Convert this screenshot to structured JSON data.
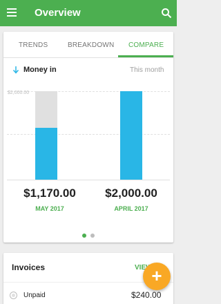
{
  "appbar": {
    "title": "Overview",
    "menu_icon": "menu-icon",
    "search_icon": "search-icon"
  },
  "tabs": [
    {
      "label": "TRENDS",
      "active": false
    },
    {
      "label": "BREAKDOWN",
      "active": false
    },
    {
      "label": "COMPARE",
      "active": true
    }
  ],
  "summary": {
    "label": "Money in",
    "period": "This month",
    "arrow_icon": "arrow-down-icon"
  },
  "chart_data": {
    "type": "bar",
    "y_tick_label": "$2,000.00",
    "ylim": [
      0,
      2000
    ],
    "categories": [
      "MAY 2017",
      "APRIL 2017"
    ],
    "series": [
      {
        "values": [
          1170,
          2000
        ],
        "color": "#29b6e6"
      }
    ],
    "comparison_ghost": {
      "value": 2000,
      "color": "#e0e0e0"
    },
    "amounts": [
      "$1,170.00",
      "$2,000.00"
    ]
  },
  "pager": {
    "count": 2,
    "active": 0
  },
  "invoices": {
    "title": "Invoices",
    "view_label": "VIEW",
    "row_label": "Unpaid",
    "row_value": "$240.00"
  },
  "colors": {
    "primary": "#4caf50",
    "bar": "#29b6e6",
    "ghost": "#e0e0e0",
    "fab": "#f9a825"
  }
}
